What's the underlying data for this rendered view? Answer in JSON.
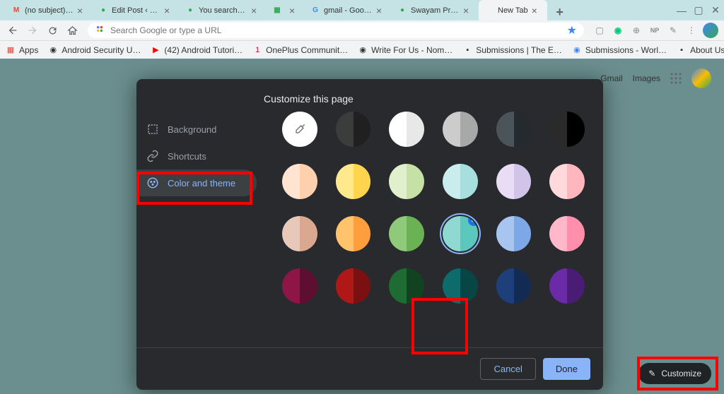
{
  "tabs": [
    {
      "title": "(no subject) - sv",
      "favicon": "M",
      "fc": "#ea4335"
    },
    {
      "title": "Edit Post ‹ Get D",
      "favicon": "●",
      "fc": "#34a853"
    },
    {
      "title": "You searched fo",
      "favicon": "●",
      "fc": "#34a853"
    },
    {
      "title": "",
      "favicon": "▦",
      "fc": "#34a853"
    },
    {
      "title": "gmail - Google S",
      "favicon": "G",
      "fc": "#4285f4"
    },
    {
      "title": "Swayam Prakasl",
      "favicon": "●",
      "fc": "#34a853"
    },
    {
      "title": "New Tab",
      "favicon": "",
      "fc": "#fff"
    }
  ],
  "omnibox": {
    "placeholder": "Search Google or type a URL"
  },
  "bookmarks": [
    {
      "label": "Apps",
      "icon": "▦",
      "c": "#ea4335"
    },
    {
      "label": "Android Security U…",
      "icon": "◉",
      "c": "#333"
    },
    {
      "label": "(42) Android Tutori…",
      "icon": "▶",
      "c": "#ff0000"
    },
    {
      "label": "OnePlus Communit…",
      "icon": "1",
      "c": "#eb0028"
    },
    {
      "label": "Write For Us - Nom…",
      "icon": "◉",
      "c": "#333"
    },
    {
      "label": "Submissions | The E…",
      "icon": "▪",
      "c": "#333"
    },
    {
      "label": "Submissions - Worl…",
      "icon": "◉",
      "c": "#4285f4"
    },
    {
      "label": "About Us | The Exp…",
      "icon": "▪",
      "c": "#333"
    }
  ],
  "ntp": {
    "gmail": "Gmail",
    "images": "Images"
  },
  "dialog": {
    "title": "Customize this page",
    "sidebar": [
      {
        "label": "Background",
        "selected": false
      },
      {
        "label": "Shortcuts",
        "selected": false
      },
      {
        "label": "Color and theme",
        "selected": true
      }
    ],
    "cancel": "Cancel",
    "done": "Done"
  },
  "customize": {
    "label": "Customize"
  },
  "swatches": [
    [
      [
        "picker"
      ],
      [
        "#3c3c3c",
        "#202020"
      ],
      [
        "#ffffff",
        "#e8e8e8"
      ],
      [
        "#cccccc",
        "#a8a8a8"
      ],
      [
        "#4a5459",
        "#252a2e"
      ],
      [
        "#2a2a2a",
        "#000000"
      ]
    ],
    [
      [
        "#ffe4d1",
        "#ffd0ae"
      ],
      [
        "#ffe98c",
        "#ffd54f"
      ],
      [
        "#e0f0cc",
        "#c5e1a5"
      ],
      [
        "#c9ecec",
        "#a7dede"
      ],
      [
        "#e8ddf5",
        "#d1c4e9"
      ],
      [
        "#ffd9dc",
        "#ffb6bd"
      ]
    ],
    [
      [
        "#e8c8b8",
        "#d9a88e"
      ],
      [
        "#ffc46b",
        "#ff9e3d"
      ],
      [
        "#8fc97a",
        "#6bb255"
      ],
      [
        "#8fd9d2",
        "#5cc7bd"
      ],
      [
        "#a8c5f0",
        "#7da8e8"
      ],
      [
        "#ffb8c9",
        "#ff8faa"
      ]
    ],
    [
      [
        "#8e1548",
        "#5e0e30"
      ],
      [
        "#b01818",
        "#7a1010"
      ],
      [
        "#1e6b33",
        "#114320"
      ],
      [
        "#0e6b6b",
        "#084545"
      ],
      [
        "#1e3f7a",
        "#132a52"
      ],
      [
        "#6b2aa8",
        "#4a1c75"
      ]
    ]
  ],
  "selected_swatch": {
    "row": 2,
    "col": 3
  }
}
